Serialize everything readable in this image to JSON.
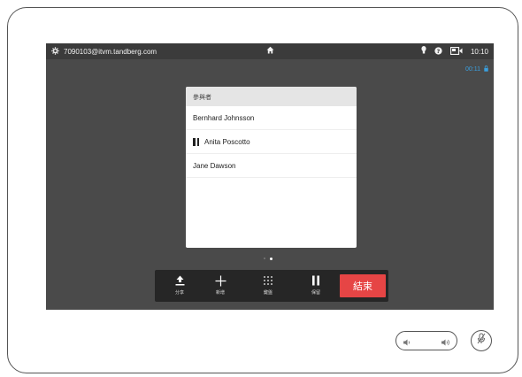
{
  "status_bar": {
    "address": "7090103@itvm.tandberg.com",
    "clock": "10:10"
  },
  "call": {
    "duration": "00:11"
  },
  "participants_panel": {
    "title": "參與者",
    "participants": [
      {
        "name": "Bernhard Johnsson",
        "status": ""
      },
      {
        "name": "Anita Poscotto",
        "status": "on-hold"
      },
      {
        "name": "Jane Dawson",
        "status": ""
      }
    ]
  },
  "pager": {
    "pages": 2,
    "active": 2
  },
  "call_controls": {
    "share_label": "分享",
    "add_label": "新增",
    "keypad_label": "鍵盤",
    "hold_label": "保留",
    "end_label": "結束"
  },
  "colors": {
    "screen_bg": "#4a4a4a",
    "status_bar_bg": "#3b3b3b",
    "accent_blue": "#3aa0e0",
    "end_red": "#e64545",
    "call_bar_bg": "#262626"
  },
  "icons": {
    "settings": "gear-icon",
    "home": "home-icon",
    "flashlight": "lightbulb-icon",
    "help": "help-icon",
    "selfview": "camera-icon",
    "lock": "lock-icon",
    "share": "upload-icon",
    "add": "plus-icon",
    "keypad": "keypad-icon",
    "hold": "pause-icon",
    "volume_down": "speaker-low-icon",
    "volume_up": "speaker-high-icon",
    "mute": "microphone-muted-icon"
  }
}
